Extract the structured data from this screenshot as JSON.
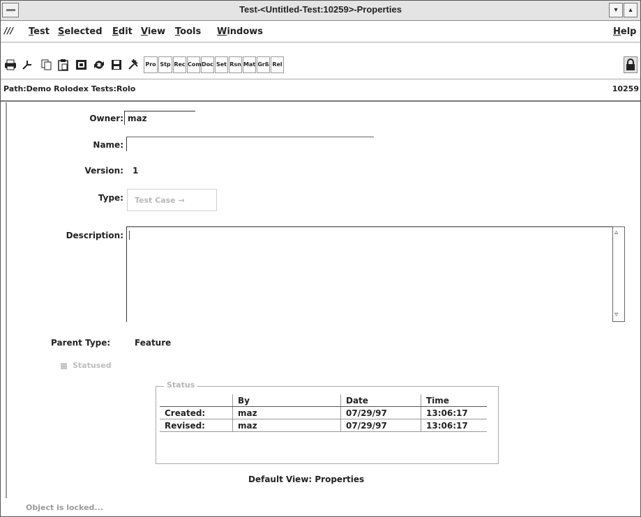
{
  "window": {
    "title": "Test-<Untitled-Test:10259>-Properties",
    "buttons": [
      "▾",
      "▴"
    ]
  },
  "menubar": {
    "logo": "///",
    "items": [
      "Test",
      "Selected",
      "Edit",
      "View",
      "Tools",
      "Windows"
    ],
    "help": "Help"
  },
  "toolbar": {
    "text_buttons": [
      "Pro",
      "Stp",
      "Rec",
      "Com",
      "Doc",
      "Set",
      "Rsn",
      "Mat",
      "Grß",
      "Rel"
    ],
    "icon_buttons": [
      "print-icon",
      "pointer-icon",
      "copy-icon",
      "paste-icon",
      "clipboard-icon",
      "refresh-icon",
      "save-icon",
      "tool-icon"
    ]
  },
  "path": {
    "text": "Path:Demo Rolodex Tests:Rolo",
    "id": "10259"
  },
  "form": {
    "owner_label": "Owner:",
    "owner_value": "maz",
    "name_label": "Name:",
    "name_value": "",
    "version_label": "Version:",
    "version_value": "1",
    "type_label": "Type:",
    "type_value": "Test Case →",
    "description_label": "Description:",
    "description_value": "",
    "parent_type_label": "Parent Type:",
    "parent_type_value": "Feature",
    "statused_label": "Statused"
  },
  "status": {
    "title": "Status",
    "headers": [
      "",
      "By",
      "Date",
      "Time"
    ],
    "rows": [
      [
        "Created:",
        "maz",
        "07/29/97",
        "13:06:17"
      ],
      [
        "Revised:",
        "maz",
        "07/29/97",
        "13:06:17"
      ]
    ]
  },
  "default_view": "Default View:  Properties",
  "status_line": "Object is locked..."
}
